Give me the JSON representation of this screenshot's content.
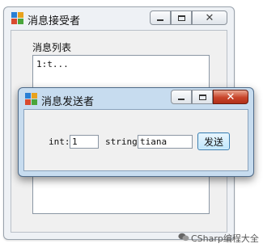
{
  "receiver": {
    "title": "消息接受者",
    "list_label": "消息列表",
    "list_items": [
      "1:t..."
    ]
  },
  "sender": {
    "title": "消息发送者",
    "int_label": "int:",
    "int_value": "1",
    "string_label": "string:",
    "string_value": "tiana",
    "send_label": "发送"
  },
  "watermark": {
    "text": "CSharp编程大全",
    "icon": "wechat-icon"
  },
  "colors": {
    "close_button": "#c8442a",
    "sender_frame": "#c7dcef",
    "send_button": "#bee6fd"
  }
}
